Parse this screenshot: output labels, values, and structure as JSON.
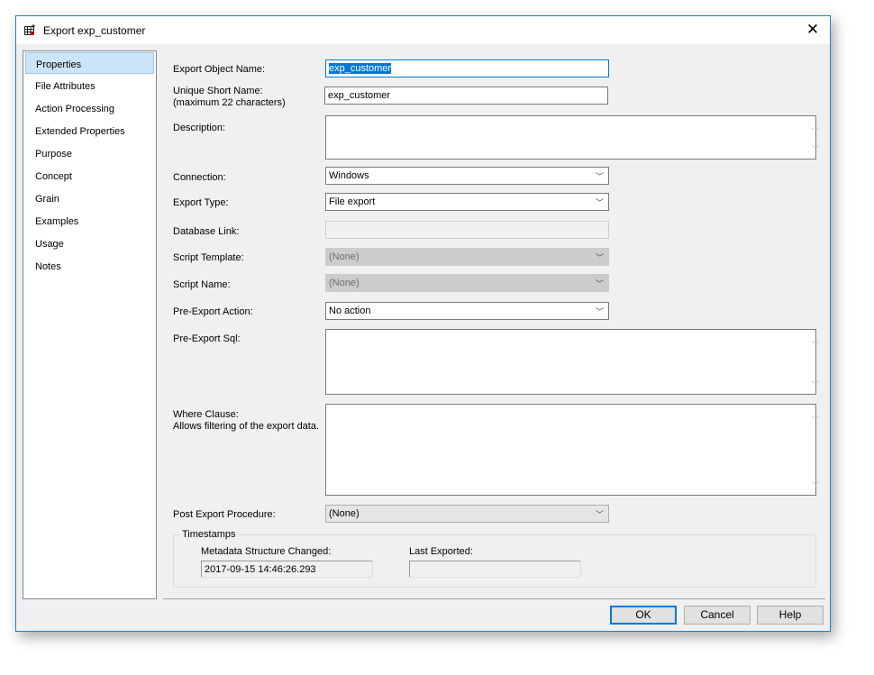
{
  "window": {
    "title": "Export exp_customer"
  },
  "sidebar": {
    "items": [
      "Properties",
      "File Attributes",
      "Action Processing",
      "Extended Properties",
      "Purpose",
      "Concept",
      "Grain",
      "Examples",
      "Usage",
      "Notes"
    ]
  },
  "form": {
    "export_object_name": {
      "label": "Export Object Name:",
      "value": "exp_customer"
    },
    "unique_short_name": {
      "label": "Unique Short Name:",
      "note": "(maximum 22 characters)",
      "value": "exp_customer"
    },
    "description": {
      "label": "Description:",
      "value": ""
    },
    "connection": {
      "label": "Connection:",
      "value": "Windows"
    },
    "export_type": {
      "label": "Export Type:",
      "value": "File export"
    },
    "database_link": {
      "label": "Database Link:",
      "value": ""
    },
    "script_template": {
      "label": "Script Template:",
      "value": "(None)"
    },
    "script_name": {
      "label": "Script Name:",
      "value": "(None)"
    },
    "pre_export_action": {
      "label": "Pre-Export Action:",
      "value": "No action"
    },
    "pre_export_sql": {
      "label": "Pre-Export Sql:",
      "value": ""
    },
    "where_clause": {
      "label": "Where Clause:",
      "note": "Allows filtering of the export data.",
      "value": ""
    },
    "post_export_procedure": {
      "label": "Post Export Procedure:",
      "value": "(None)"
    }
  },
  "timestamps": {
    "title": "Timestamps",
    "metadata_label": "Metadata Structure Changed:",
    "metadata_value": "2017-09-15 14:46:26.293",
    "last_exported_label": "Last Exported:",
    "last_exported_value": ""
  },
  "buttons": {
    "ok": "OK",
    "cancel": "Cancel",
    "help": "Help"
  },
  "close_glyph": "✕"
}
